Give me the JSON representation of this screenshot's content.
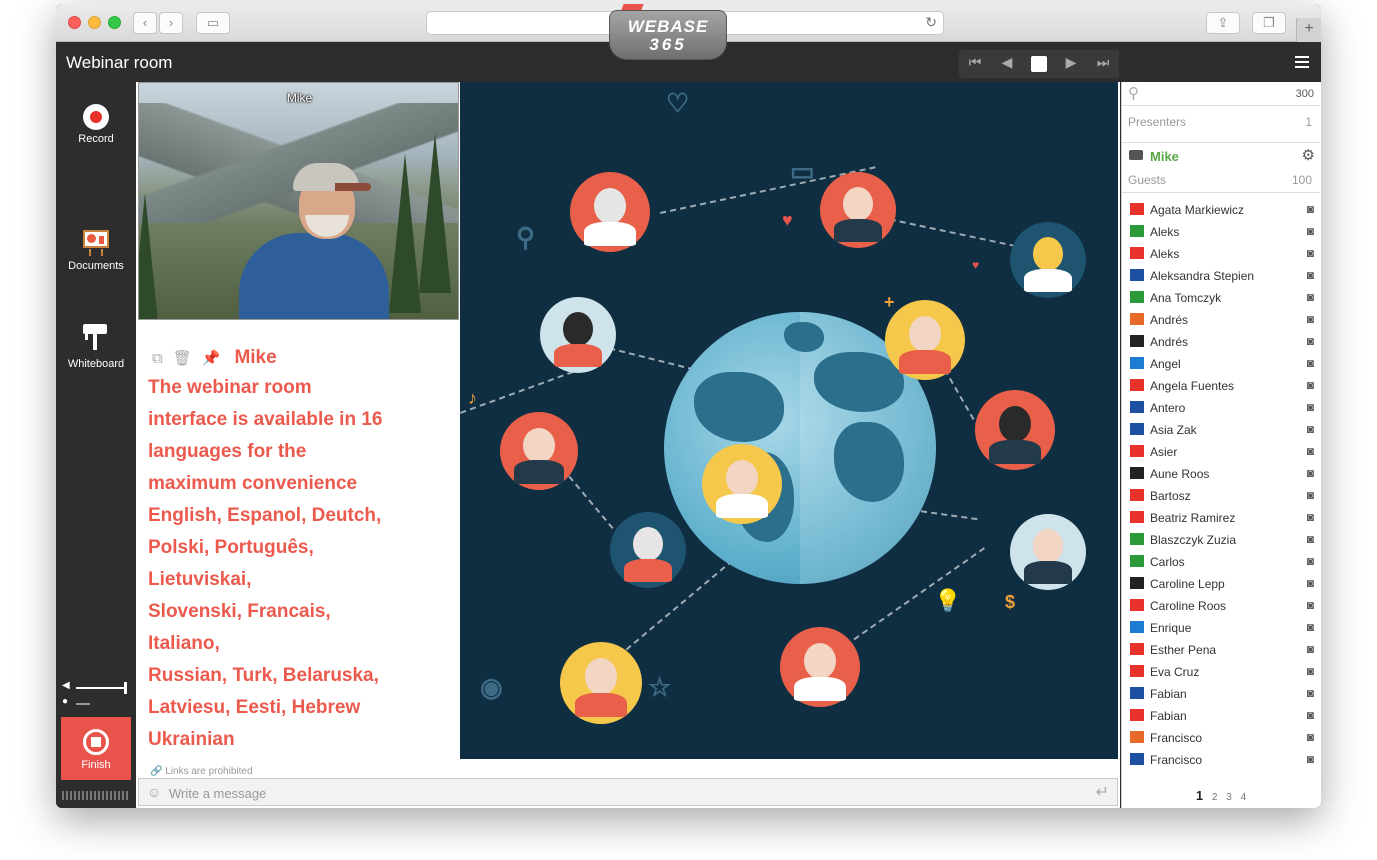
{
  "app": {
    "title": "Webinar room"
  },
  "logo": {
    "line1": "WEBASE",
    "line2": "365"
  },
  "pager": {
    "first": "⏮",
    "prev": "◀",
    "next": "▶",
    "last": "⏭"
  },
  "rail": {
    "record": "Record",
    "documents": "Documents",
    "whiteboard": "Whiteboard",
    "finish": "Finish"
  },
  "video": {
    "name": "Mike"
  },
  "chat": {
    "author": "Mike",
    "message": "The webinar room\ninterface is available in 16\nlanguages for the\nmaximum convenience\nEnglish, Espanol, Deutch,\nPolski, Português,\nLietuviskai,\nSlovenski, Francais,\nItaliano,\nRussian, Turk, Belaruska,\nLatviesu, Eesti, Hebrew\nUkrainian",
    "links_note": "Links are prohibited",
    "placeholder": "Write a message"
  },
  "sidebar": {
    "total": "300",
    "presenters_label": "Presenters",
    "presenters_count": "1",
    "presenter_name": "Mike",
    "guests_label": "Guests",
    "guests_count": "100",
    "guests": [
      {
        "name": "Agata Markiewicz",
        "flag": "#e8312a"
      },
      {
        "name": "Aleks",
        "flag": "#2b9b3a"
      },
      {
        "name": "Aleks",
        "flag": "#e8312a"
      },
      {
        "name": "Aleksandra Stepien",
        "flag": "#1d4fa3"
      },
      {
        "name": "Ana Tomczyk",
        "flag": "#2b9b3a"
      },
      {
        "name": "Andrés",
        "flag": "#e86a2a"
      },
      {
        "name": "Andrés",
        "flag": "#222222"
      },
      {
        "name": "Angel",
        "flag": "#1d7bd1"
      },
      {
        "name": "Angela Fuentes",
        "flag": "#e8312a"
      },
      {
        "name": "Antero",
        "flag": "#1d4fa3"
      },
      {
        "name": "Asia Zak",
        "flag": "#1d4fa3"
      },
      {
        "name": "Asier",
        "flag": "#e8312a"
      },
      {
        "name": "Aune Roos",
        "flag": "#222222"
      },
      {
        "name": "Bartosz",
        "flag": "#e8312a"
      },
      {
        "name": "Beatriz Ramirez",
        "flag": "#e8312a"
      },
      {
        "name": "Blaszczyk Zuzia",
        "flag": "#2b9b3a"
      },
      {
        "name": "Carlos",
        "flag": "#2b9b3a"
      },
      {
        "name": "Caroline Lepp",
        "flag": "#222222"
      },
      {
        "name": "Caroline Roos",
        "flag": "#e8312a"
      },
      {
        "name": "Enrique",
        "flag": "#1d7bd1"
      },
      {
        "name": "Esther Pena",
        "flag": "#e8312a"
      },
      {
        "name": "Eva Cruz",
        "flag": "#e8312a"
      },
      {
        "name": "Fabian",
        "flag": "#1d4fa3"
      },
      {
        "name": "Fabian",
        "flag": "#e8312a"
      },
      {
        "name": "Francisco",
        "flag": "#e86a2a"
      },
      {
        "name": "Francisco",
        "flag": "#1d4fa3"
      }
    ],
    "pages": [
      "1",
      "2",
      "3",
      "4"
    ]
  }
}
